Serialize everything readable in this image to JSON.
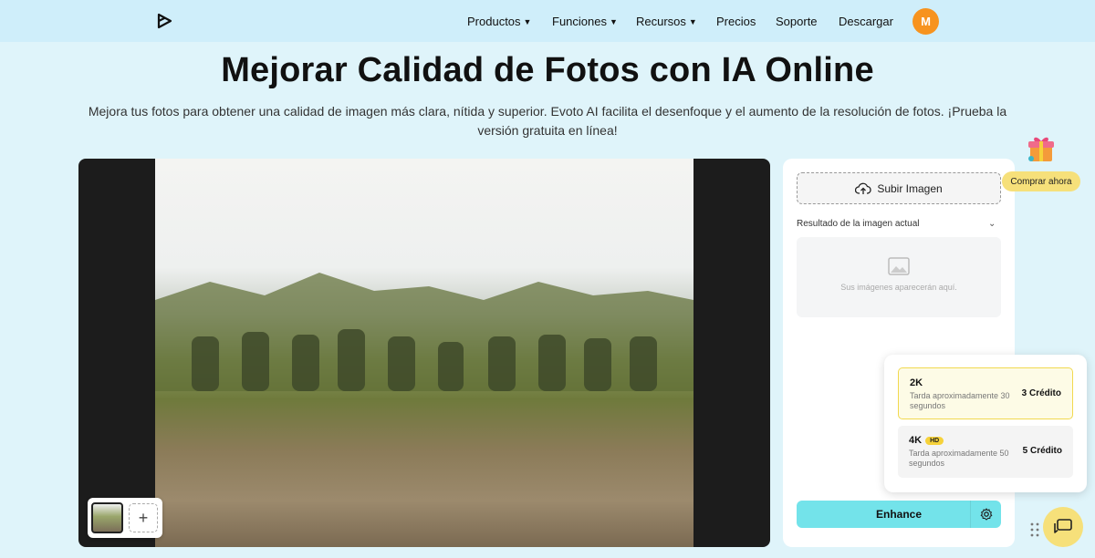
{
  "nav": {
    "items": [
      {
        "label": "Productos",
        "has_caret": true
      },
      {
        "label": "Funciones",
        "has_caret": true
      },
      {
        "label": "Recursos",
        "has_caret": true
      },
      {
        "label": "Precios",
        "has_caret": false
      },
      {
        "label": "Soporte",
        "has_caret": false
      },
      {
        "label": "Descargar",
        "has_caret": false
      }
    ],
    "avatar_initial": "M",
    "logo_icon": "evoto-logo-icon"
  },
  "hero": {
    "title": "Mejorar Calidad de Fotos con IA Online",
    "subtitle": "Mejora tus fotos para obtener una calidad de imagen más clara, nítida y superior. Evoto AI facilita el desenfoque y el aumento de la resolución de fotos. ¡Prueba la versión gratuita en línea!"
  },
  "panel": {
    "upload_label": "Subir Imagen",
    "result_label": "Resultado de la imagen actual",
    "placeholder_text": "Sus imágenes aparecerán aquí.",
    "enhance_label": "Enhance"
  },
  "quality": {
    "options": [
      {
        "name": "2K",
        "hd": false,
        "desc": "Tarda aproximadamente 30 segundos",
        "credit": "3 Crédito",
        "selected": true
      },
      {
        "name": "4K",
        "hd": true,
        "hd_label": "HD",
        "desc": "Tarda aproximadamente 50 segundos",
        "credit": "5 Crédito",
        "selected": false
      }
    ]
  },
  "promo": {
    "buy_label": "Comprar ahora"
  },
  "thumbs": {
    "add_label": "+"
  },
  "colors": {
    "background": "#dff4fa",
    "topbar": "#cfeefa",
    "accent_cyan": "#73e3ea",
    "avatar_orange": "#f7931e",
    "highlight_yellow": "#f6e07a"
  }
}
